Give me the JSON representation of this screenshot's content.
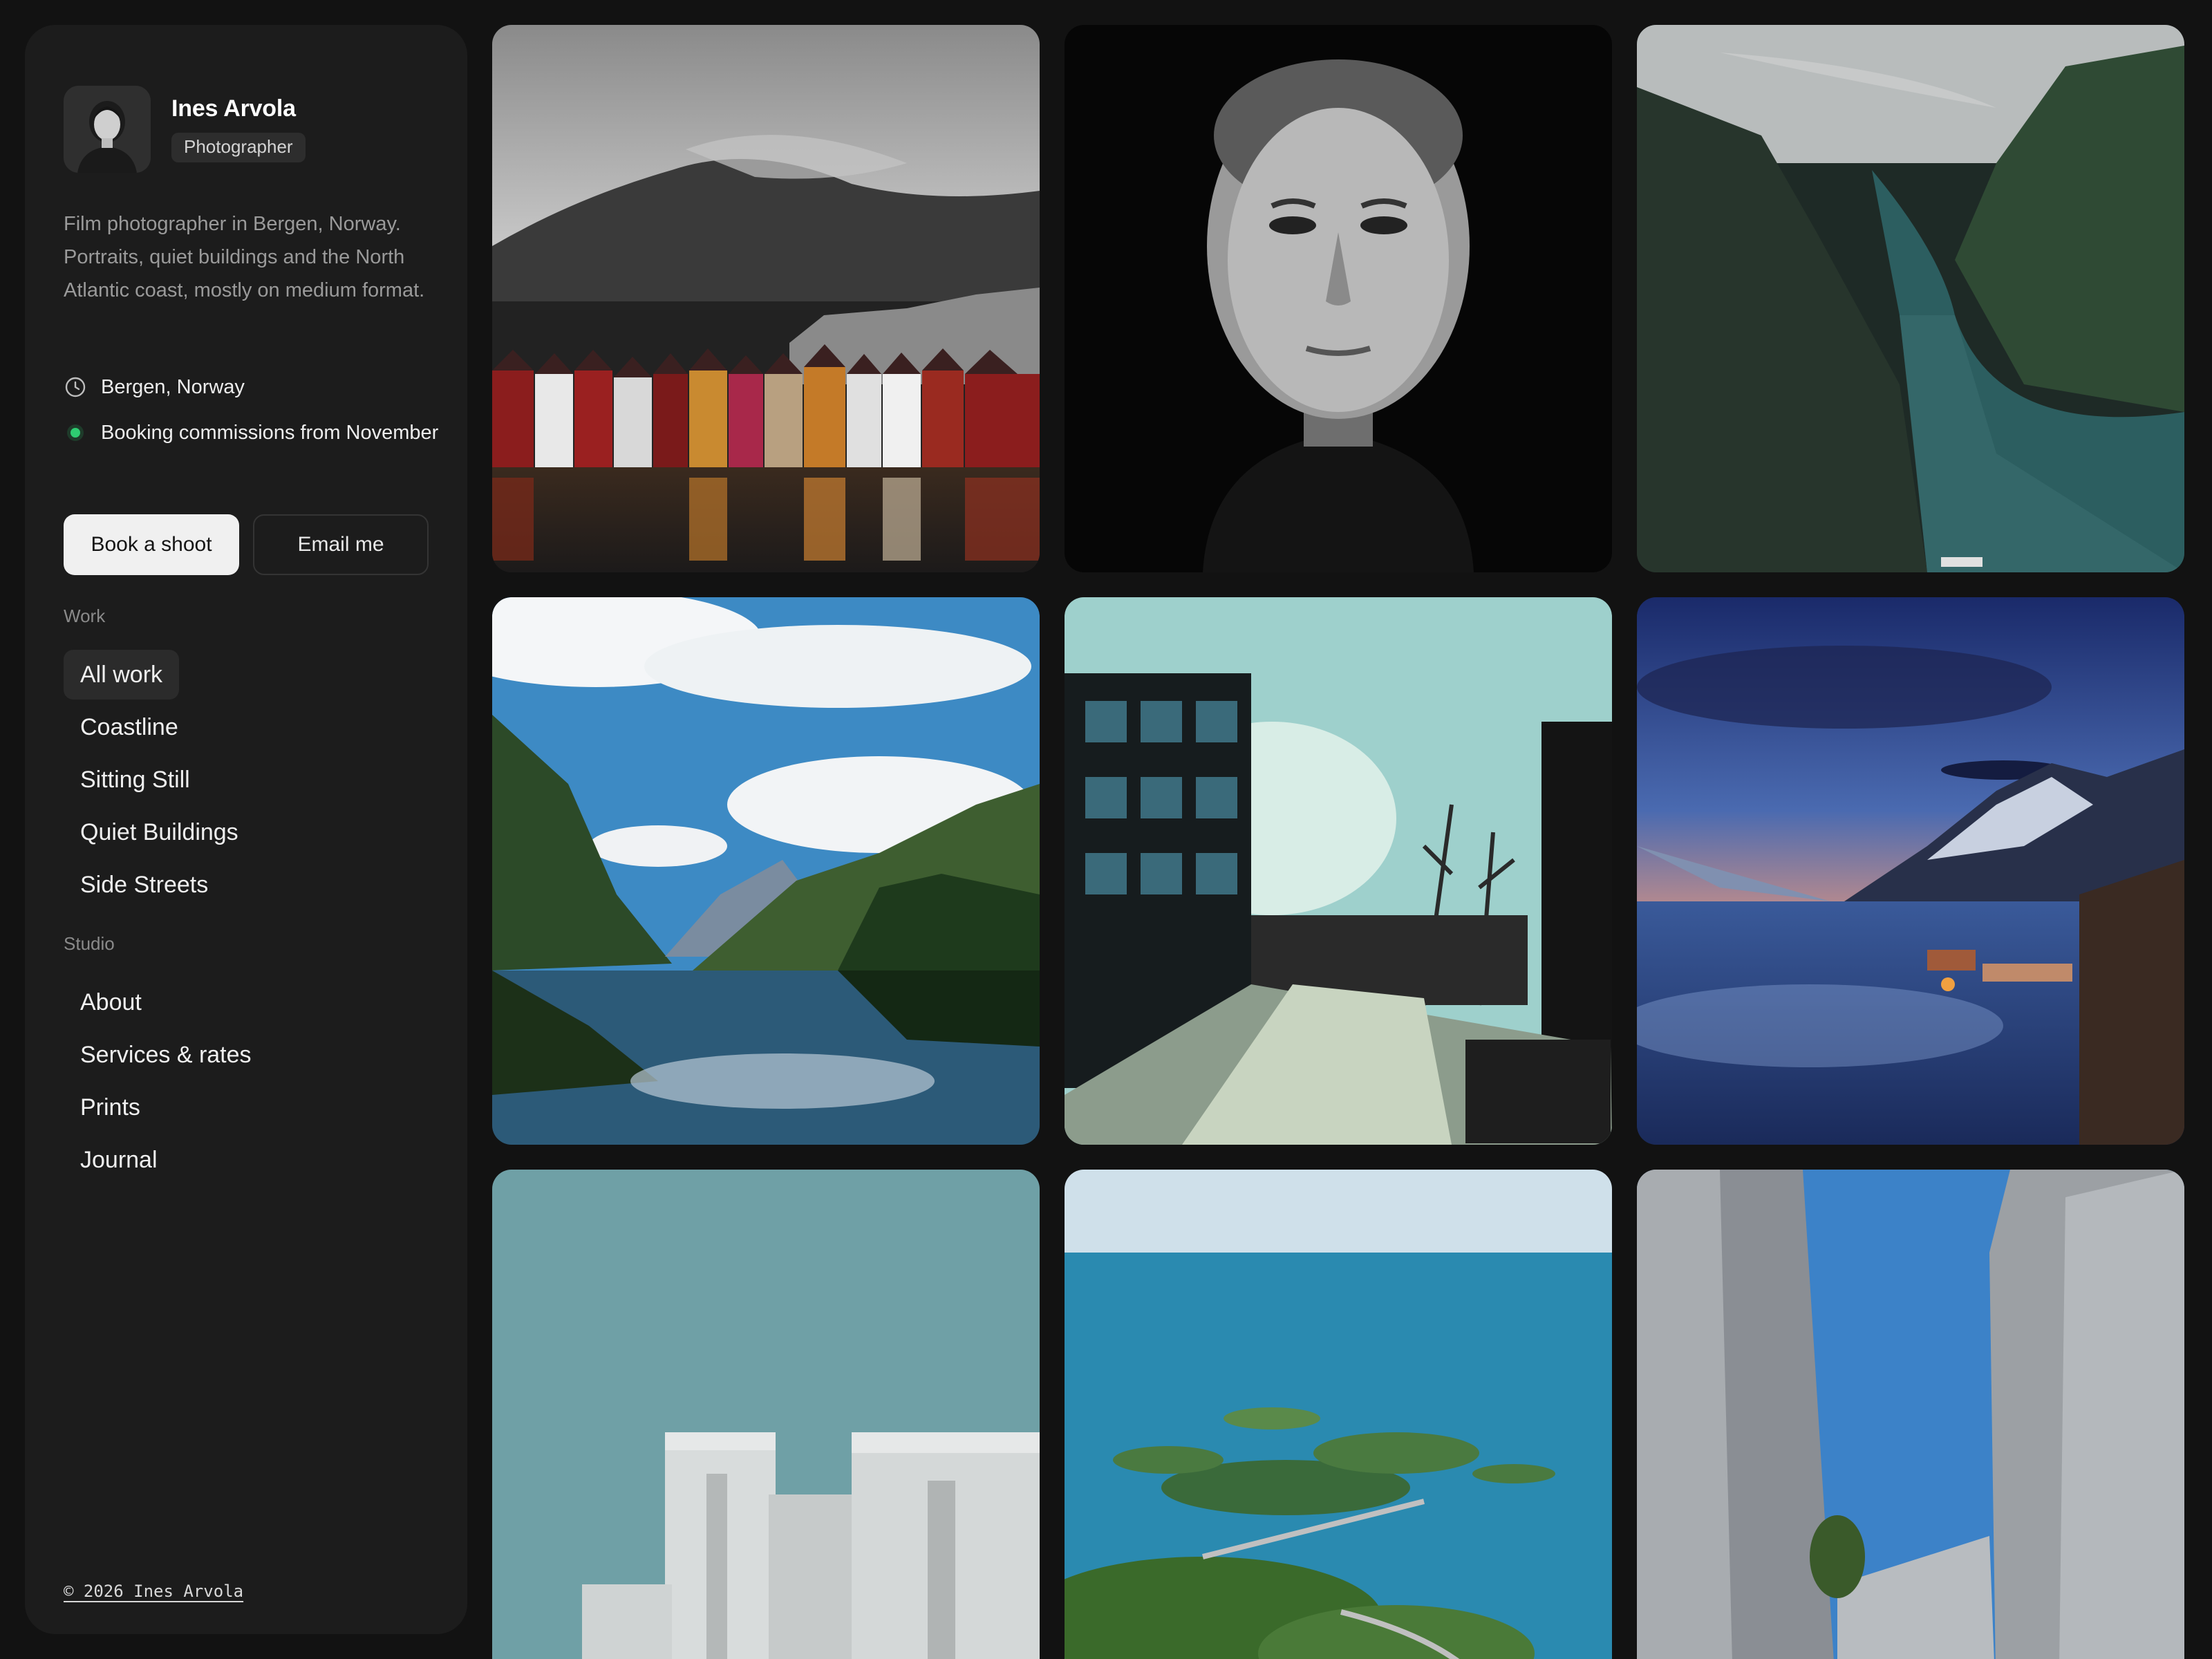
{
  "profile": {
    "name": "Ines Arvola",
    "role": "Photographer",
    "bio": "Film photographer in Bergen, Norway. Portraits, quiet buildings and the North Atlantic coast, mostly on medium format.",
    "location": "Bergen, Norway",
    "availability": "Booking commissions from November",
    "location_icon": "clock-icon",
    "status_color": "#2ecc71"
  },
  "actions": {
    "primary_label": "Book a shoot",
    "secondary_label": "Email me"
  },
  "work": {
    "label": "Work",
    "items": [
      {
        "label": "All work",
        "active": true
      },
      {
        "label": "Coastline",
        "active": false
      },
      {
        "label": "Sitting Still",
        "active": false
      },
      {
        "label": "Quiet Buildings",
        "active": false
      },
      {
        "label": "Side Streets",
        "active": false
      }
    ]
  },
  "studio": {
    "label": "Studio",
    "items": [
      {
        "label": "About"
      },
      {
        "label": "Services & rates"
      },
      {
        "label": "Prints"
      },
      {
        "label": "Journal"
      }
    ]
  },
  "footer": {
    "copyright": "© 2026 Ines Arvola"
  },
  "gallery": {
    "photos": [
      {
        "subject": "bergen-waterfront"
      },
      {
        "subject": "bw-portrait"
      },
      {
        "subject": "fjord-aerial"
      },
      {
        "subject": "mountain-lake-reflection"
      },
      {
        "subject": "street-sunlit-building"
      },
      {
        "subject": "dusk-harbour"
      },
      {
        "subject": "concrete-building-sky"
      },
      {
        "subject": "island-archipelago"
      },
      {
        "subject": "concrete-walls-sky"
      }
    ]
  }
}
